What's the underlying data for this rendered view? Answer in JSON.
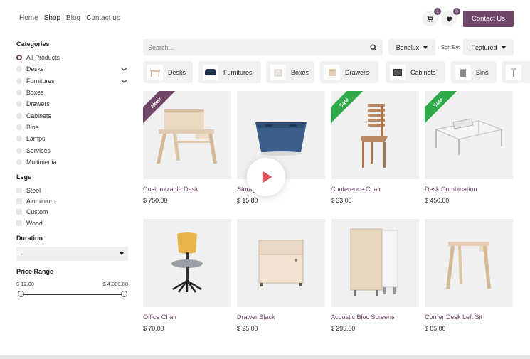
{
  "nav": {
    "items": [
      "Home",
      "Shop",
      "Blog",
      "Contact us"
    ],
    "active": "Shop"
  },
  "header": {
    "cart_count": "1",
    "wishlist_count": "0",
    "contact_label": "Contact Us"
  },
  "sidebar": {
    "categories_title": "Categories",
    "categories": [
      "All Products",
      "Desks",
      "Furnitures",
      "Boxes",
      "Drawers",
      "Cabinets",
      "Bins",
      "Lamps",
      "Services",
      "Multimedia"
    ],
    "legs_title": "Legs",
    "legs": [
      "Steel",
      "Aluminium",
      "Custom",
      "Wood"
    ],
    "duration_title": "Duration",
    "duration_value": "-",
    "price_title": "Price Range",
    "price_min": "$ 12.00",
    "price_max": "$ 4,000.00"
  },
  "toolbar": {
    "search_placeholder": "Search...",
    "pricelist": "Benelux",
    "sort_label": "Sort By:",
    "sort_value": "Featured"
  },
  "chips": [
    "Desks",
    "Furnitures",
    "Boxes",
    "Drawers",
    "Cabinets",
    "Bins",
    ""
  ],
  "products": [
    {
      "name": "Customizable Desk",
      "price": "$ 750.00",
      "ribbon": "New!"
    },
    {
      "name": "Storage Box",
      "price": "$ 15.80",
      "ribbon": ""
    },
    {
      "name": "Conference Chair",
      "price": "$ 33.00",
      "ribbon": "Sale"
    },
    {
      "name": "Desk Combination",
      "price": "$ 450.00",
      "ribbon": "Sale"
    },
    {
      "name": "Office Chair",
      "price": "$ 70.00",
      "ribbon": ""
    },
    {
      "name": "Drawer Black",
      "price": "$ 25.00",
      "ribbon": ""
    },
    {
      "name": "Acoustic Bloc Screens",
      "price": "$ 295.00",
      "ribbon": ""
    },
    {
      "name": "Corner Desk Left Sit",
      "price": "$ 85.00",
      "ribbon": ""
    }
  ],
  "colors": {
    "brand": "#6f4668",
    "sale": "#2faa4a",
    "play": "#e8505b"
  }
}
